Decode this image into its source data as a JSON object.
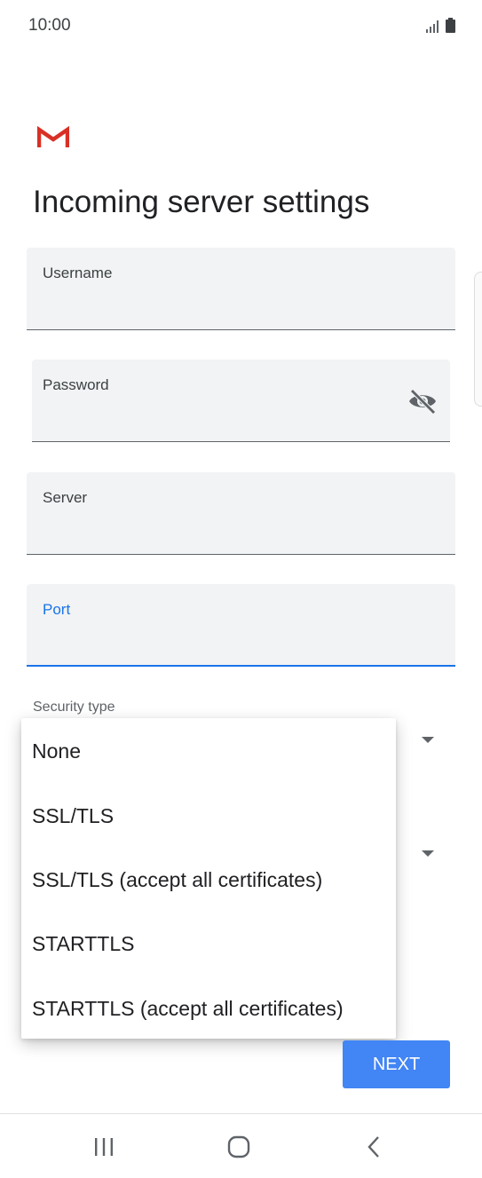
{
  "status_bar": {
    "time": "10:00",
    "icons": [
      "signal-icon",
      "battery-icon"
    ]
  },
  "app": {
    "logo": "gmail-logo-icon"
  },
  "page": {
    "title": "Incoming server settings"
  },
  "fields": {
    "username": {
      "label": "Username",
      "value": ""
    },
    "password": {
      "label": "Password",
      "value": ""
    },
    "server": {
      "label": "Server",
      "value": ""
    },
    "port": {
      "label": "Port",
      "value": ""
    }
  },
  "security": {
    "label": "Security type",
    "options": [
      "None",
      "SSL/TLS",
      "SSL/TLS (accept all certificates)",
      "STARTTLS",
      "STARTTLS (accept all certificates)"
    ]
  },
  "buttons": {
    "next_label": "NEXT"
  },
  "nav": {
    "icons": [
      "recent-apps-icon",
      "home-icon",
      "back-icon"
    ]
  },
  "colors": {
    "accent": "#1a73e8",
    "button": "#4285f4",
    "field_bg": "#f1f3f4",
    "gmail_red": "#d93025"
  }
}
